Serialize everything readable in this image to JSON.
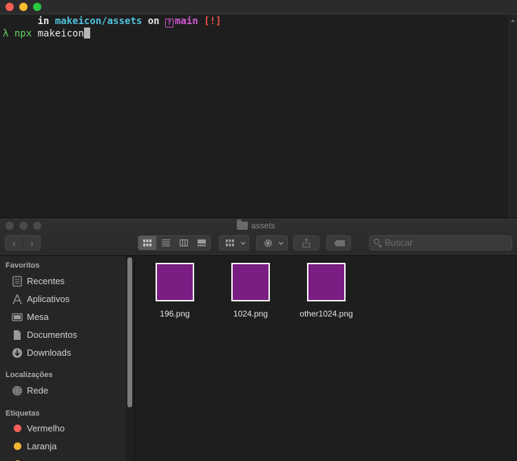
{
  "terminal": {
    "prompt_in": "in",
    "path": "makeicon/assets",
    "prompt_on": "on",
    "branch_glyph": "?",
    "branch": "main",
    "status": "[!]",
    "lambda": "λ",
    "command_npx": "npx",
    "command_arg": "makeicon"
  },
  "finder": {
    "title": "assets",
    "nav": {
      "back": "‹",
      "forward": "›"
    },
    "search_placeholder": "Buscar",
    "sidebar": {
      "favorites_heading": "Favoritos",
      "favorites": [
        {
          "label": "Recentes",
          "icon": "clock-icon"
        },
        {
          "label": "Aplicativos",
          "icon": "applications-icon"
        },
        {
          "label": "Mesa",
          "icon": "desktop-icon"
        },
        {
          "label": "Documentos",
          "icon": "document-icon"
        },
        {
          "label": "Downloads",
          "icon": "download-icon"
        }
      ],
      "locations_heading": "Localizações",
      "locations": [
        {
          "label": "Rede",
          "icon": "network-icon"
        }
      ],
      "tags_heading": "Etiquetas",
      "tags": [
        {
          "label": "Vermelho",
          "color": "#fe5f57"
        },
        {
          "label": "Laranja",
          "color": "#f5b731"
        }
      ]
    },
    "files": [
      {
        "name": "196.png",
        "color": "#7a1e83"
      },
      {
        "name": "1024.png",
        "color": "#7a1e83"
      },
      {
        "name": "other1024.png",
        "color": "#7a1e83"
      }
    ]
  }
}
